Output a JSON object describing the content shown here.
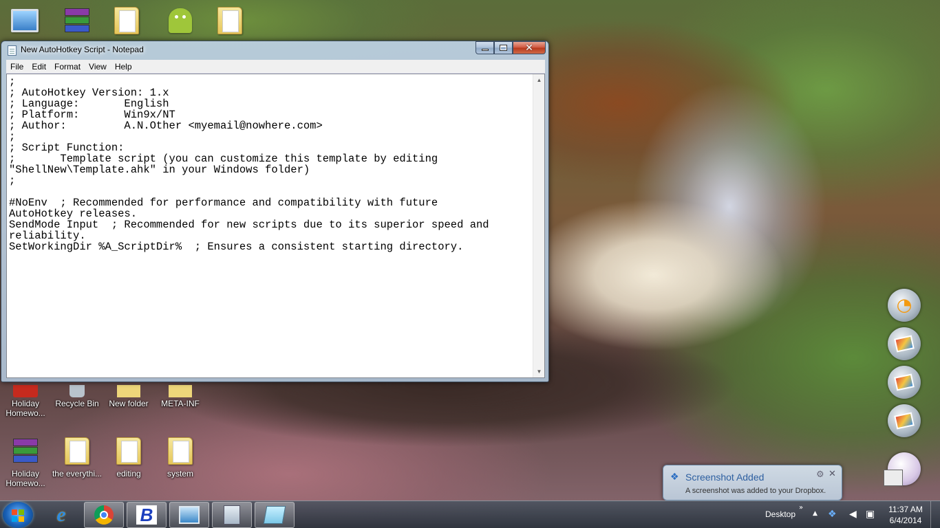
{
  "desktop": {
    "top_icons": [
      "computer-icon",
      "winrar-icon",
      "folder-icon",
      "android-icon",
      "folder-docs-icon"
    ],
    "icons": [
      {
        "label": "Holiday Homewo...",
        "icon": "pdf-icon"
      },
      {
        "label": "Recycle Bin",
        "icon": "recycle-bin-icon"
      },
      {
        "label": "New folder",
        "icon": "folder-icon"
      },
      {
        "label": "META-INF",
        "icon": "folder-icon"
      },
      {
        "label": "Holiday Homewo...",
        "icon": "winrar-icon"
      },
      {
        "label": "the everythi...",
        "icon": "folder-icon"
      },
      {
        "label": "editing",
        "icon": "folder-icon"
      },
      {
        "label": "system",
        "icon": "folder-icon"
      }
    ]
  },
  "window": {
    "title": "New AutoHotkey Script - Notepad",
    "minimize": "minimize",
    "maximize": "maximize",
    "close": "✕",
    "menu": [
      "File",
      "Edit",
      "Format",
      "View",
      "Help"
    ],
    "content": ";\n; AutoHotkey Version: 1.x\n; Language:       English\n; Platform:       Win9x/NT\n; Author:         A.N.Other <myemail@nowhere.com>\n;\n; Script Function:\n;\tTemplate script (you can customize this template by editing\n\"ShellNew\\Template.ahk\" in your Windows folder)\n;\n\n#NoEnv  ; Recommended for performance and compatibility with future\nAutoHotkey releases.\nSendMode Input  ; Recommended for new scripts due to its superior speed and\nreliability.\nSetWorkingDir %A_ScriptDir%  ; Ensures a consistent starting directory."
  },
  "notification": {
    "title": "Screenshot Added",
    "message": "A screenshot was added to your Dropbox."
  },
  "taskbar": {
    "apps": [
      "start-button",
      "internet-explorer-icon",
      "chrome-icon",
      "b-app-icon",
      "remote-desktop-icon",
      "calculator-icon",
      "notepad-icon"
    ],
    "desktop_label": "Desktop",
    "chevron": "»",
    "clock": {
      "time": "11:37 AM",
      "date": "6/4/2014"
    }
  },
  "colors": {
    "taskbar": "#2d3a47",
    "notepad_bg": "#ffffff",
    "notification_title": "#2d5fa0"
  }
}
